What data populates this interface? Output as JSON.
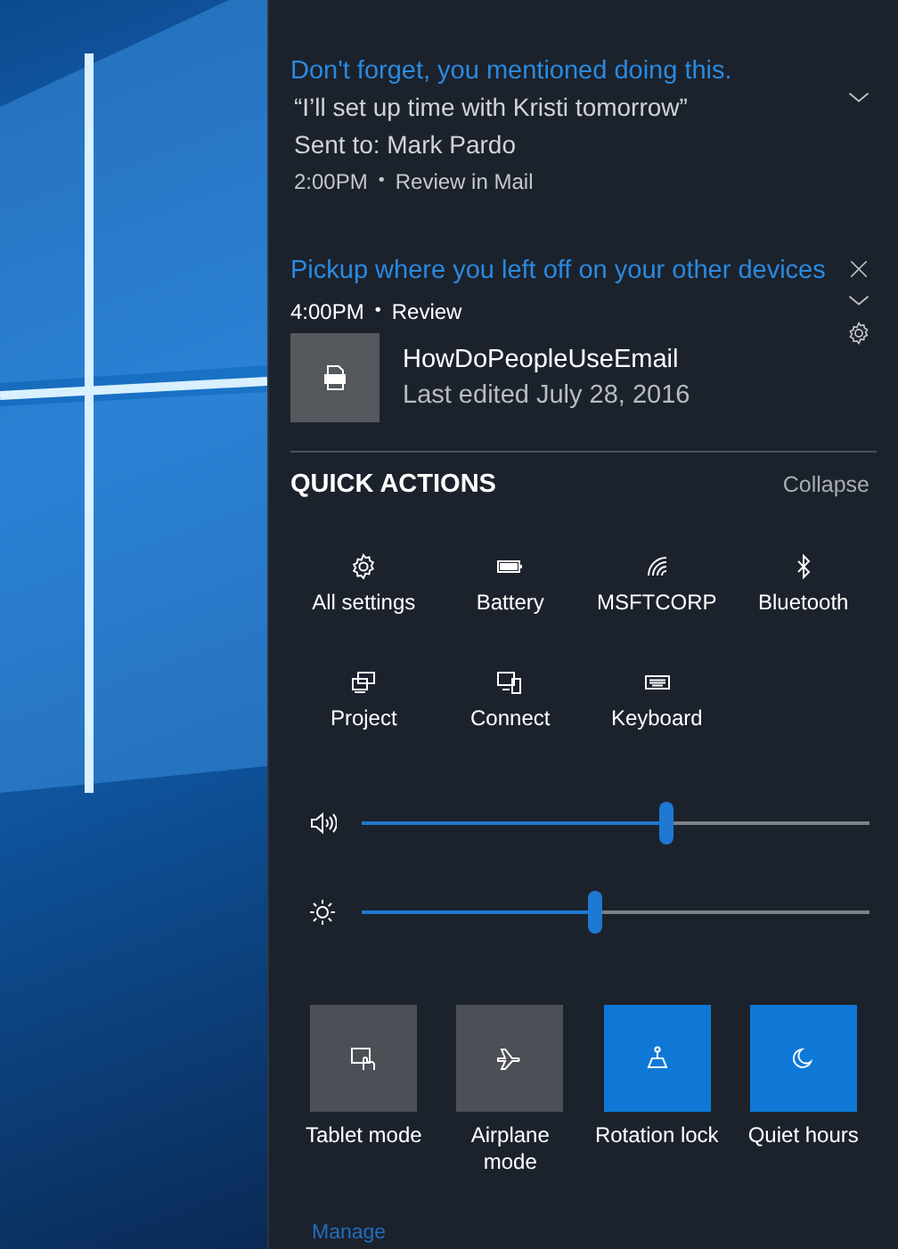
{
  "notifications": [
    {
      "kind": "reminder",
      "title": "Don't forget, you mentioned doing this.",
      "lines": [
        "“I’ll set up time with Kristi tomorrow”",
        "Sent to: Mark Pardo"
      ],
      "time": "2:00PM",
      "separator": "•",
      "source": "Review in Mail"
    },
    {
      "kind": "pickup",
      "title": "Pickup where you left off on your other devices",
      "time": "4:00PM",
      "separator": "•",
      "source": "Review",
      "file": {
        "name": "HowDoPeopleUseEmail",
        "detail": "Last edited July 28, 2016"
      }
    }
  ],
  "quick_actions": {
    "title": "QUICK ACTIONS",
    "collapse": "Collapse",
    "actions": [
      {
        "label": "All settings"
      },
      {
        "label": "Battery"
      },
      {
        "label": "MSFTCORP"
      },
      {
        "label": "Bluetooth"
      },
      {
        "label": "Project"
      },
      {
        "label": "Connect"
      },
      {
        "label": "Keyboard"
      }
    ],
    "sliders": [
      {
        "kind": "volume",
        "level": 0.6
      },
      {
        "kind": "brightness",
        "level": 0.46
      }
    ],
    "tiles": [
      {
        "label": "Tablet mode",
        "on": false
      },
      {
        "label": "Airplane mode",
        "on": false
      },
      {
        "label": "Rotation lock",
        "on": true
      },
      {
        "label": "Quiet hours",
        "on": true
      }
    ],
    "manage": "Manage"
  }
}
